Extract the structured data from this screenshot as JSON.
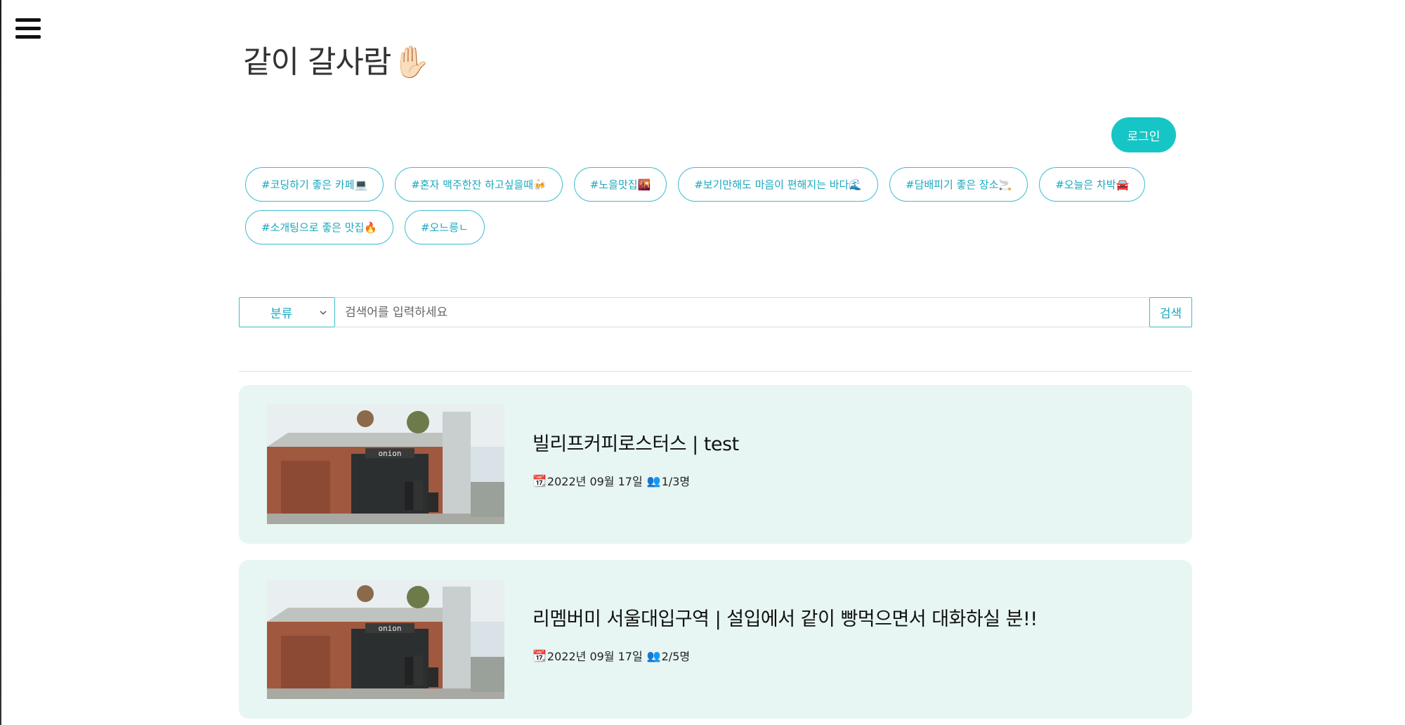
{
  "header": {
    "title": "같이 갈사람",
    "hand_icon": "✋🏻",
    "menu_icon": "hamburger-icon"
  },
  "auth": {
    "login_label": "로그인"
  },
  "hashtags": {
    "row1": [
      "#코딩하기 좋은 카페💻",
      "#혼자 맥주한잔 하고싶을때🍻",
      "#노을맛집🌇",
      "#보기만해도 마음이 편해지는 바다🌊",
      "#담배피기 좋은 장소🚬",
      "#오늘은 차박🚘"
    ],
    "row2": [
      "#소개팅으로 좋은 맛집🔥",
      "#오느릉ㄴ"
    ]
  },
  "search": {
    "category_label": "분류",
    "placeholder": "검색어를 입력하세요",
    "button_label": "검색"
  },
  "posts": [
    {
      "title": "빌리프커피로스터스 | test",
      "calendar_icon": "📆",
      "date": "2022년 09월 17일",
      "people_icon": "👥",
      "participants": "1/3명",
      "image_text": "onion"
    },
    {
      "title": "리멤버미 서울대입구역 | 설입에서 같이 빵먹으면서 대화하실 분!!",
      "calendar_icon": "📆",
      "date": "2022년 09월 17일",
      "people_icon": "👥",
      "participants": "2/5명",
      "image_text": "onion"
    }
  ],
  "colors": {
    "accent": "#16c5c5",
    "tag_border": "#3cbcd0",
    "tag_text": "#1aa7bd",
    "card_bg": "#e7f6f2"
  }
}
